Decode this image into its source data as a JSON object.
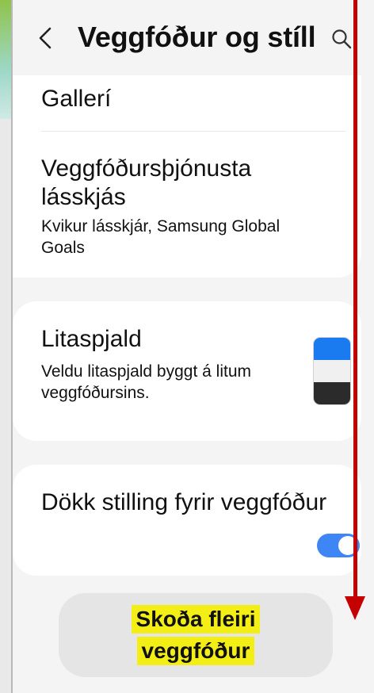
{
  "header": {
    "title": "Veggfóður og stíll",
    "back_icon": "chevron-left-icon",
    "search_icon": "search-icon"
  },
  "items": {
    "gallery": {
      "label": "Gallerí"
    },
    "lockscreen_service": {
      "title_line1": "Veggfóðursþjónusta",
      "title_line2": "lásskjás",
      "sub_line1": "Kvikur lásskjár, Samsung Global",
      "sub_line2": "Goals"
    },
    "palette": {
      "title": "Litaspjald",
      "sub_line1": "Veldu litaspjald byggt á litum",
      "sub_line2": "veggfóðursins.",
      "colors": [
        "#1a7bf0",
        "#f0f0f0",
        "#2b2b2b"
      ]
    },
    "dark_mode": {
      "title": "Dökk stilling fyrir veggfóður",
      "toggle_on": true,
      "toggle_color": "#3e86f5"
    }
  },
  "more_button": {
    "line1": "Skoða fleiri",
    "line2": "veggfóður",
    "highlight_color": "#f2ee16"
  },
  "annotation": {
    "arrow_color": "#c40000"
  }
}
